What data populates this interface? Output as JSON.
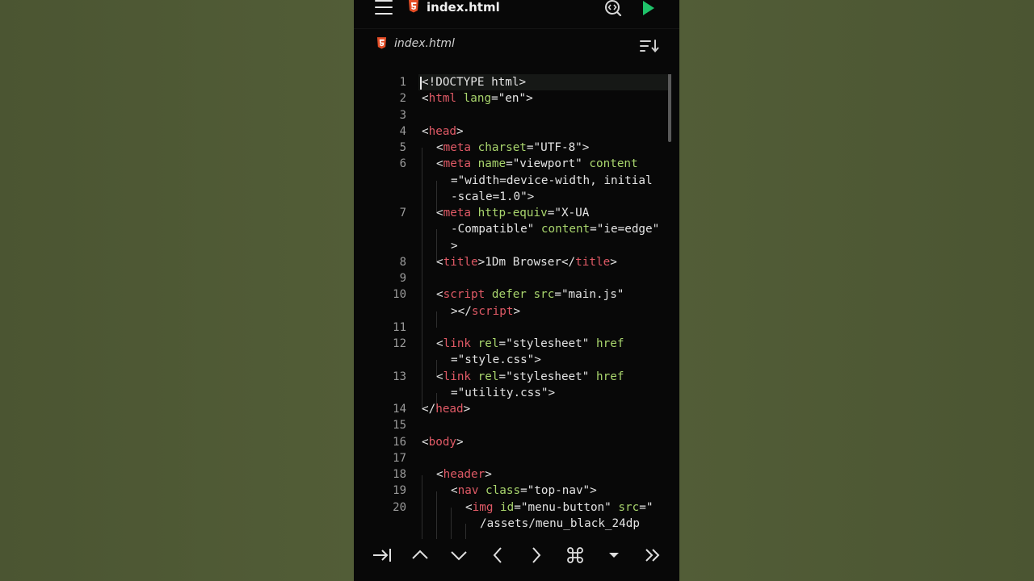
{
  "app": {
    "file_title": "index.html",
    "tab_label": "index.html"
  },
  "icons": {
    "menu": "hamburger-menu-icon",
    "file_type": "html5-icon",
    "search_code": "search-code-icon",
    "run": "play-icon",
    "sort": "sort-icon"
  },
  "colors": {
    "tag": "#e05a66",
    "attribute": "#a9d56d",
    "run_button": "#1fc26a",
    "html5_badge": "#e44d26"
  },
  "editor": {
    "line_numbers": [
      "1",
      "2",
      "3",
      "4",
      "5",
      "6",
      "7",
      "8",
      "9",
      "10",
      "11",
      "12",
      "13",
      "14",
      "15",
      "16",
      "17",
      "18",
      "19",
      "20"
    ],
    "code": {
      "l1": "<!DOCTYPE html>",
      "l2a": "<",
      "l2b": "html",
      "l2c": " lang",
      "l2d": "=\"en\">",
      "l4a": "<",
      "l4b": "head",
      "l4c": ">",
      "l5a": "<",
      "l5b": "meta",
      "l5c": " charset",
      "l5d": "=\"UTF-8\">",
      "l6a": "<",
      "l6b": "meta",
      "l6c": " name",
      "l6d": "=\"viewport\" ",
      "l6e": "content",
      "l6w1": "=\"width=device-width, initial",
      "l6w2": "-scale=1.0\">",
      "l7a": "<",
      "l7b": "meta",
      "l7c": " http-equiv",
      "l7d": "=\"X-UA",
      "l7w1a": "-Compatible\" ",
      "l7w1b": "content",
      "l7w1c": "=\"ie=edge\"",
      "l7w2": ">",
      "l8a": "<",
      "l8b": "title",
      "l8c": ">1Dm Browser</",
      "l8d": "title",
      "l8e": ">",
      "l10a": "<",
      "l10b": "script",
      "l10c": " defer src",
      "l10d": "=\"main.js\"",
      "l10w1a": "></",
      "l10w1b": "script",
      "l10w1c": ">",
      "l12a": "<",
      "l12b": "link",
      "l12c": " rel",
      "l12d": "=\"stylesheet\" ",
      "l12e": "href",
      "l12w1": "=\"style.css\">",
      "l13a": "<",
      "l13b": "link",
      "l13c": " rel",
      "l13d": "=\"stylesheet\" ",
      "l13e": "href",
      "l13w1": "=\"utility.css\">",
      "l14a": "</",
      "l14b": "head",
      "l14c": ">",
      "l16a": "<",
      "l16b": "body",
      "l16c": ">",
      "l18a": "<",
      "l18b": "header",
      "l18c": ">",
      "l19a": "<",
      "l19b": "nav",
      "l19c": " class",
      "l19d": "=\"top-nav\">",
      "l20a": "<",
      "l20b": "img",
      "l20c": " id",
      "l20d": "=\"menu-button\" ",
      "l20e": "src",
      "l20f": "=\"",
      "l20w1": "/assets/menu_black_24dp"
    }
  },
  "bottom_keys": [
    "tab-key-icon",
    "arrow-up-icon",
    "arrow-down-icon",
    "arrow-left-icon",
    "arrow-right-icon",
    "command-icon",
    "dropdown-triangle-icon",
    "double-chevron-right-icon"
  ]
}
